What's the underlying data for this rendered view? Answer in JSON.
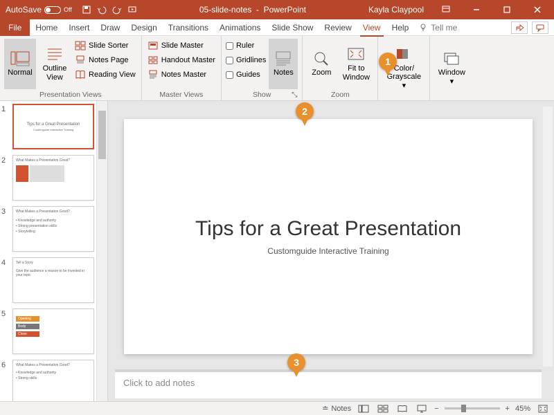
{
  "titlebar": {
    "autosave_label": "AutoSave",
    "autosave_state": "Off",
    "doc_name": "05-slide-notes",
    "app_name": "PowerPoint",
    "user": "Kayla Claypool"
  },
  "menu": {
    "tabs": [
      "File",
      "Home",
      "Insert",
      "Draw",
      "Design",
      "Transitions",
      "Animations",
      "Slide Show",
      "Review",
      "View",
      "Help"
    ],
    "active": "View",
    "tellme": "Tell me"
  },
  "ribbon": {
    "presentation_views": {
      "label": "Presentation Views",
      "normal": "Normal",
      "outline": "Outline View",
      "slide_sorter": "Slide Sorter",
      "notes_page": "Notes Page",
      "reading_view": "Reading View"
    },
    "master_views": {
      "label": "Master Views",
      "slide_master": "Slide Master",
      "handout_master": "Handout Master",
      "notes_master": "Notes Master"
    },
    "show": {
      "label": "Show",
      "ruler": "Ruler",
      "gridlines": "Gridlines",
      "guides": "Guides",
      "notes": "Notes"
    },
    "zoom": {
      "label": "Zoom",
      "zoom": "Zoom",
      "fit": "Fit to Window"
    },
    "color": {
      "label": "Color/ Grayscale"
    },
    "window": {
      "label": "Window"
    }
  },
  "slide": {
    "title": "Tips for a Great Presentation",
    "subtitle": "Customguide Interactive Training"
  },
  "thumbs": {
    "items": [
      {
        "n": "1",
        "title": "Tips for a Great Presentation"
      },
      {
        "n": "2",
        "title": "What Makes a Presentation Great?"
      },
      {
        "n": "3",
        "title": "What Makes a Presentation Good?"
      },
      {
        "n": "4",
        "title": "Tell a Story"
      },
      {
        "n": "5",
        "title": "Opening / Body / Close"
      },
      {
        "n": "6",
        "title": "What Makes a Presentation Good?"
      }
    ]
  },
  "notes_placeholder": "Click to add notes",
  "status": {
    "notes_btn": "Notes",
    "zoom_pct": "45%"
  },
  "callouts": {
    "c1": "1",
    "c2": "2",
    "c3": "3"
  }
}
